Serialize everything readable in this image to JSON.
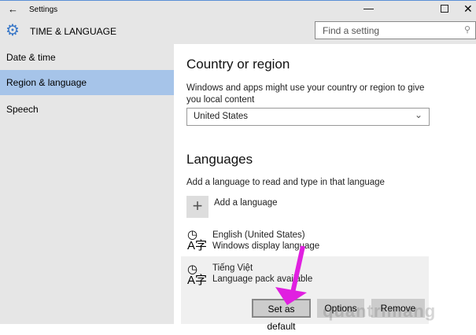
{
  "window": {
    "title": "Settings"
  },
  "header": {
    "title": "TIME & LANGUAGE",
    "search_placeholder": "Find a setting"
  },
  "sidebar": {
    "items": [
      {
        "label": "Date & time"
      },
      {
        "label": "Region & language",
        "selected": true
      },
      {
        "label": "Speech"
      }
    ]
  },
  "country": {
    "heading": "Country or region",
    "description": "Windows and apps might use your country or region to give you local content",
    "selected": "United States"
  },
  "languages": {
    "heading": "Languages",
    "description": "Add a language to read and type in that language",
    "add_label": "Add a language",
    "items": [
      {
        "name": "English (United States)",
        "status": "Windows display language"
      },
      {
        "name": "Tiếng Việt",
        "status": "Language pack available"
      }
    ],
    "buttons": {
      "set_default": "Set as default",
      "options": "Options",
      "remove": "Remove"
    }
  },
  "watermark": "quantrimang",
  "colors": {
    "selected": "#a6c4e9",
    "arrow": "#e020e0",
    "accent": "#3a78c8"
  }
}
